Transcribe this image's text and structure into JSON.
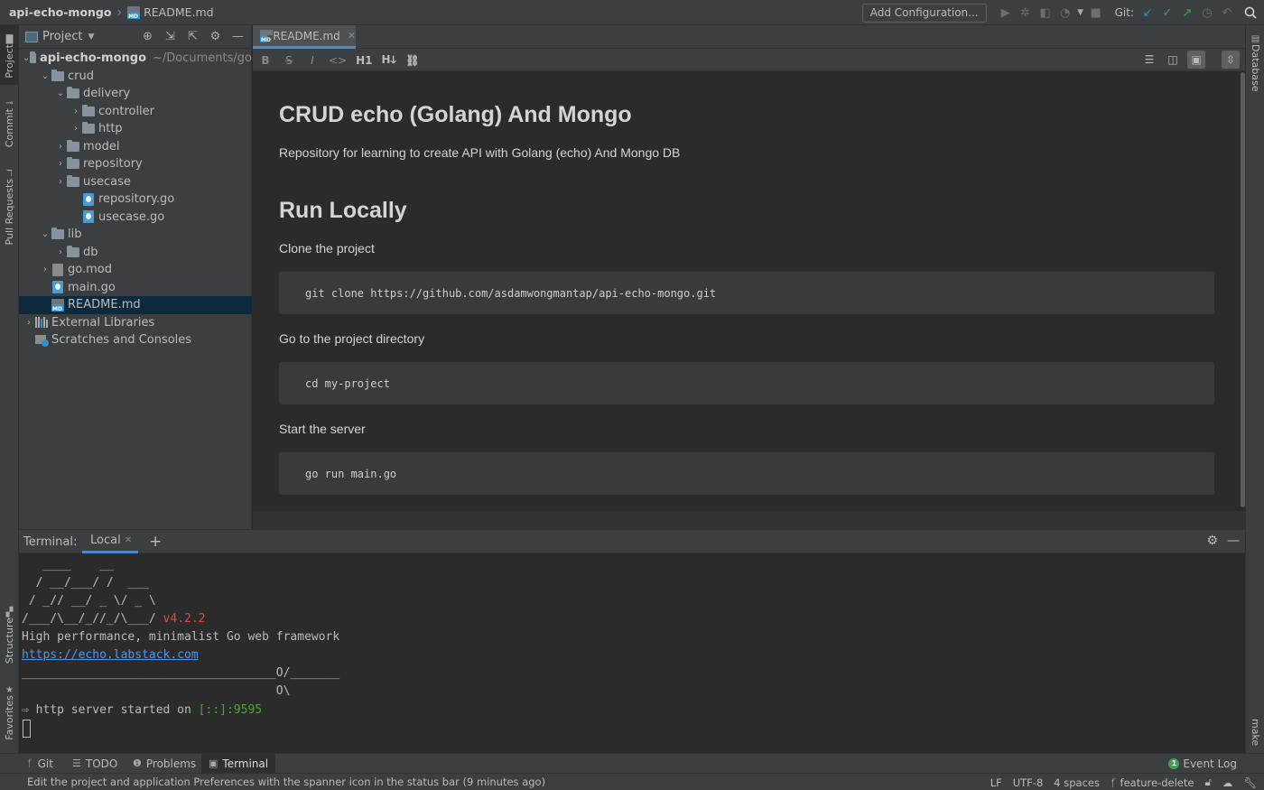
{
  "navbar": {
    "project": "api-echo-mongo",
    "file": "README.md",
    "add_configuration": "Add Configuration...",
    "git_label": "Git:"
  },
  "left_stripe": {
    "project": "Project",
    "commit": "Commit",
    "pull_requests": "Pull Requests",
    "structure": "Structure",
    "favorites": "Favorites"
  },
  "right_stripe": {
    "database": "Database",
    "make": "make"
  },
  "project_panel": {
    "title": "Project",
    "root": "api-echo-mongo",
    "root_path": "~/Documents/go",
    "items": [
      {
        "label": "crud"
      },
      {
        "label": "delivery"
      },
      {
        "label": "controller"
      },
      {
        "label": "http"
      },
      {
        "label": "model"
      },
      {
        "label": "repository"
      },
      {
        "label": "usecase"
      },
      {
        "label": "repository.go"
      },
      {
        "label": "usecase.go"
      },
      {
        "label": "lib"
      },
      {
        "label": "db"
      },
      {
        "label": "go.mod"
      },
      {
        "label": "main.go"
      },
      {
        "label": "README.md"
      },
      {
        "label": "External Libraries"
      },
      {
        "label": "Scratches and Consoles"
      }
    ]
  },
  "editor": {
    "tab_label": "README.md",
    "toolbar": {
      "bold": "B",
      "strike": "S",
      "italic": "I",
      "code": "<>",
      "h1": "H1",
      "heading": "Hↆ",
      "link": "⛓"
    },
    "preview": {
      "h1": "CRUD echo (Golang) And Mongo",
      "intro": "Repository for learning to create API with Golang (echo) And Mongo DB",
      "h2": "Run Locally",
      "step1": "Clone the project",
      "code1": "git clone https://github.com/asdamwongmantap/api-echo-mongo.git",
      "step2": "Go to the project directory",
      "code2": "cd my-project",
      "step3": "Start the server",
      "code3": "go run main.go"
    }
  },
  "terminal": {
    "label": "Terminal:",
    "tab": "Local",
    "lines": [
      "   ____    __",
      "  / __/___/ /  ___",
      " / _// __/ _ \\/ _ \\",
      "/___/\\__/_//_/\\___/ "
    ],
    "version": "v4.2.2",
    "tagline": "High performance, minimalist Go web framework",
    "url": "https://echo.labstack.com",
    "rule": "____________________________________O/_______",
    "rule2": "                                    O\\",
    "started_prefix": "⇨ http server started on ",
    "address": "[::]:9595"
  },
  "bottom_tools": {
    "git": "Git",
    "todo": "TODO",
    "problems": "Problems",
    "terminal": "Terminal",
    "event_log": "Event Log",
    "event_count": "1"
  },
  "status": {
    "message": "Edit the project and application Preferences with the spanner icon in the status bar (9 minutes ago)",
    "line_sep": "LF",
    "encoding": "UTF-8",
    "indent": "4 spaces",
    "branch": "feature-delete"
  },
  "colors": {
    "accent": "#4a88c7",
    "selection": "#0d293e",
    "version_red": "#e0474f",
    "address_green": "#54a23d",
    "link_blue": "#5394ec"
  }
}
